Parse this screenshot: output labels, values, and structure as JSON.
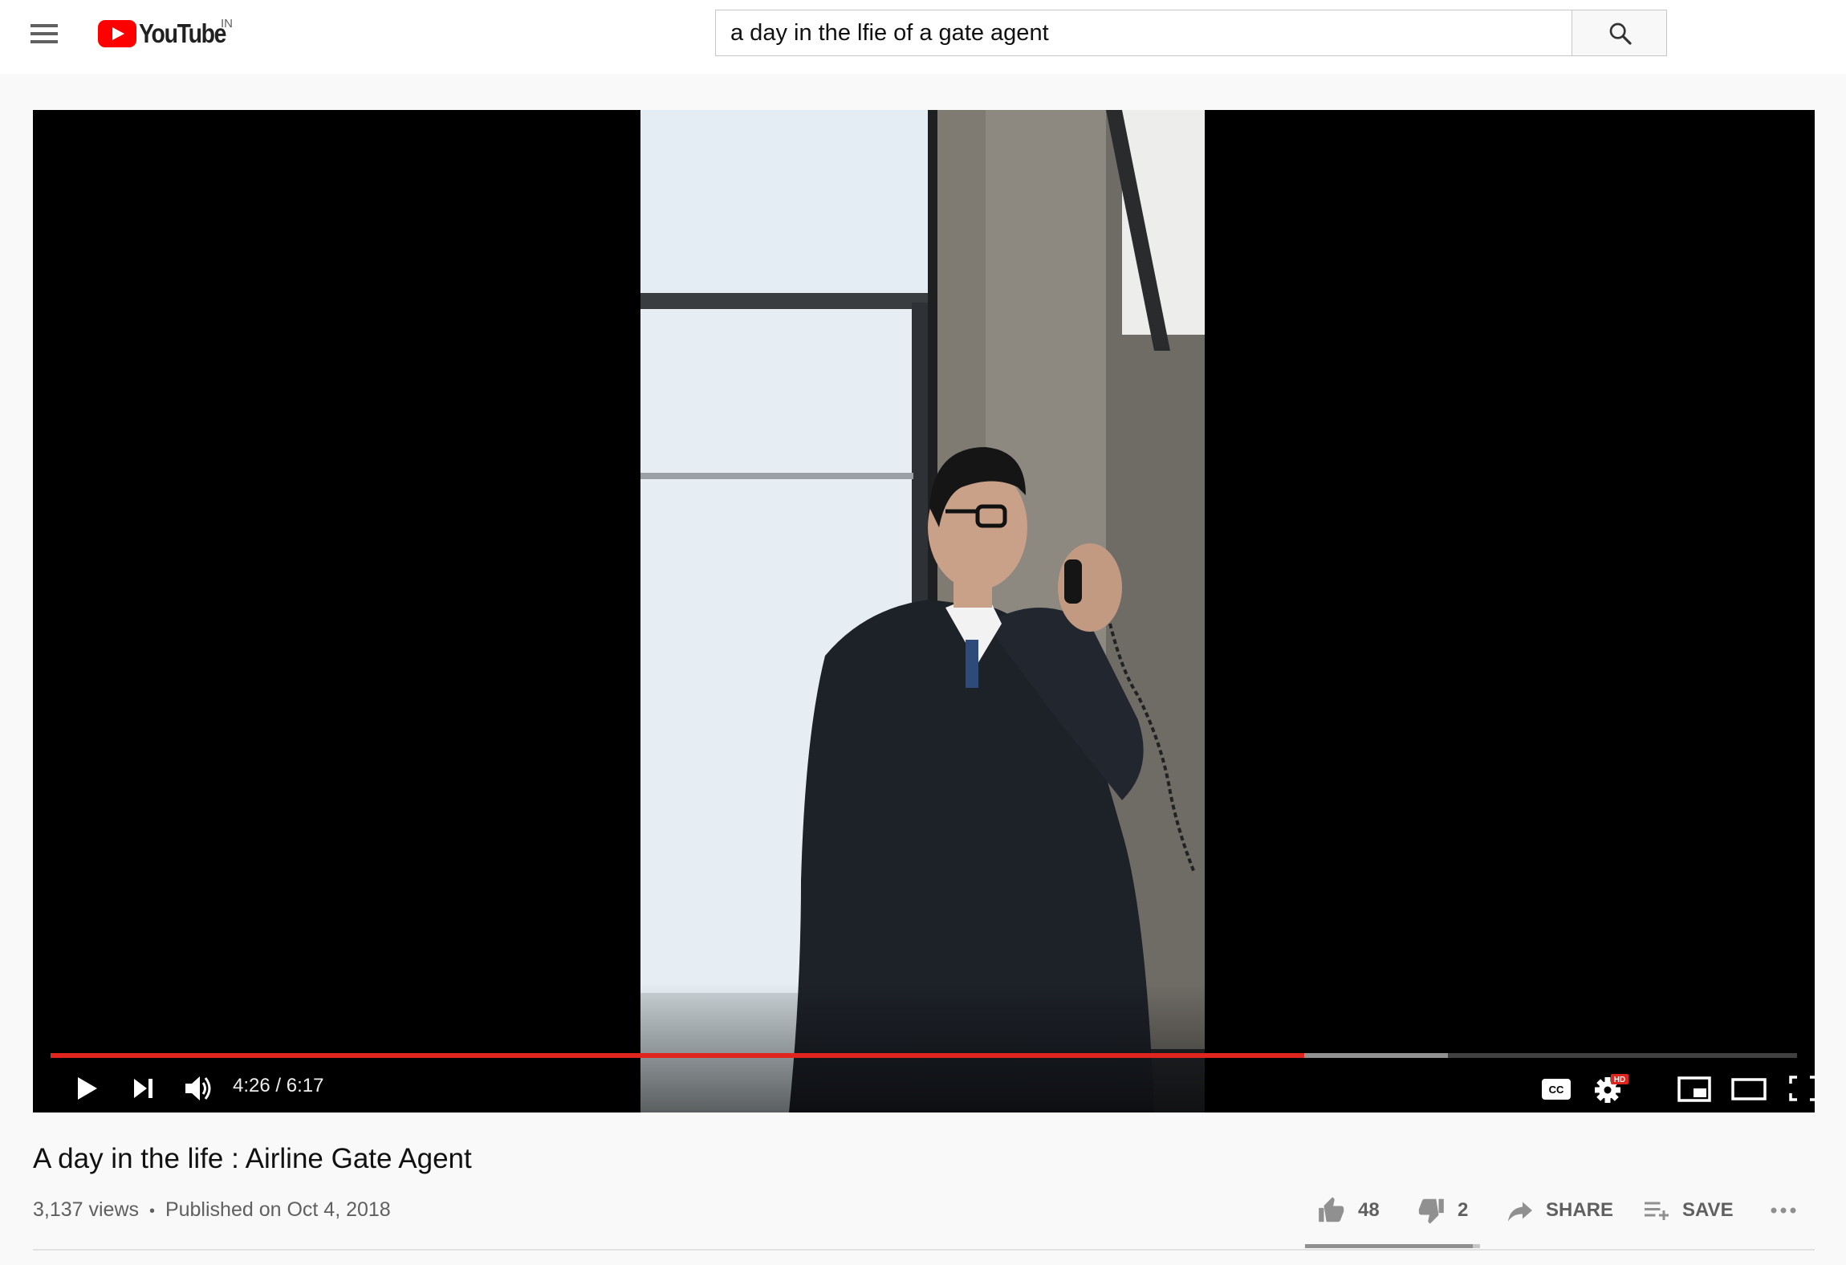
{
  "header": {
    "logo_text": "YouTube",
    "country_code": "IN",
    "search_value": "a day in the lfie of a gate agent",
    "menu_icon": "hamburger-menu-icon",
    "search_icon": "search-icon"
  },
  "player": {
    "time_display": "4:26 / 6:17",
    "progress_fraction": 0.718,
    "buffered_fraction": 0.8,
    "controls": [
      "play-icon",
      "next-icon",
      "volume-icon",
      "captions-icon",
      "settings-icon",
      "miniplayer-icon",
      "theater-icon",
      "fullscreen-icon"
    ],
    "hd_badge": "HD",
    "cc_label": "CC",
    "accent_color": "#e0241e"
  },
  "video": {
    "title": "A day in the life : Airline Gate Agent",
    "views": "3,137 views",
    "separator": "•",
    "published": "Published on Oct 4, 2018",
    "likes": "48",
    "dislikes": "2",
    "like_fraction": 0.96,
    "share_label": "SHARE",
    "save_label": "SAVE"
  }
}
